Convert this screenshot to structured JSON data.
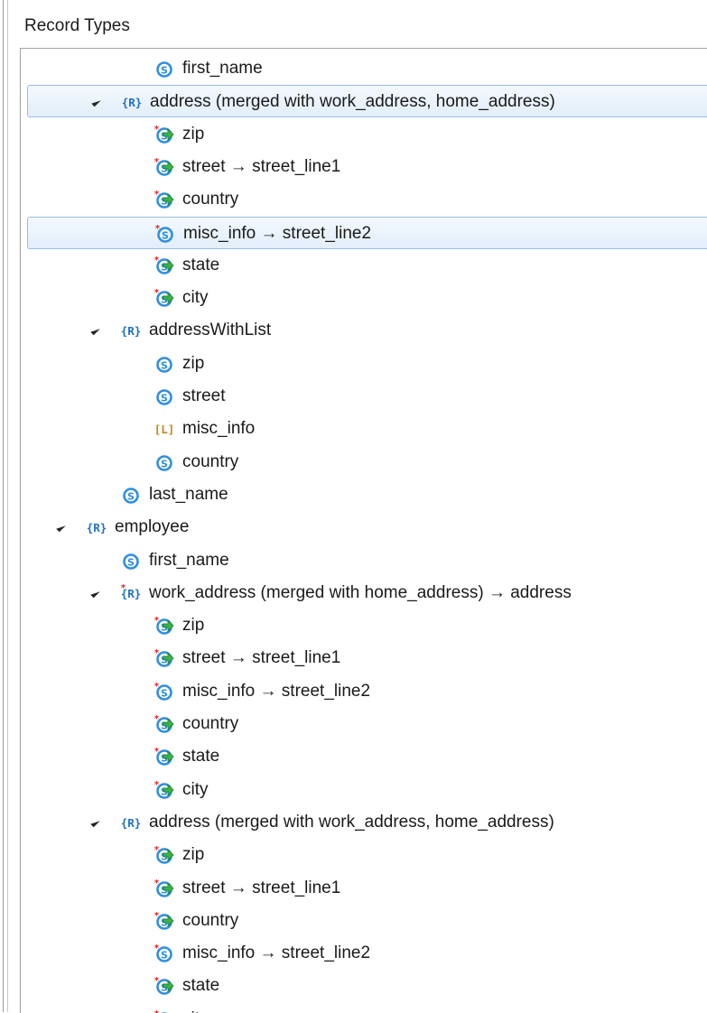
{
  "view": {
    "title": "Record Types"
  },
  "tree": {
    "rows": [
      {
        "label": "first_name",
        "type": "string"
      },
      {
        "label": "address (merged with work_address, home_address)",
        "type": "record",
        "expanded": true
      },
      {
        "label": "zip",
        "type": "string-mapped"
      },
      {
        "label": "street → street_line1",
        "type": "string-mapped"
      },
      {
        "label": "country",
        "type": "string-mapped"
      },
      {
        "label": "misc_info → street_line2",
        "type": "string-renamed"
      },
      {
        "label": "state",
        "type": "string-mapped"
      },
      {
        "label": "city",
        "type": "string-mapped"
      },
      {
        "label": "addressWithList",
        "type": "record",
        "expanded": true
      },
      {
        "label": "zip",
        "type": "string"
      },
      {
        "label": "street",
        "type": "string"
      },
      {
        "label": "misc_info",
        "type": "list"
      },
      {
        "label": "country",
        "type": "string"
      },
      {
        "label": "last_name",
        "type": "string"
      },
      {
        "label": "employee",
        "type": "record",
        "expanded": true
      },
      {
        "label": "first_name",
        "type": "string"
      },
      {
        "label": "work_address (merged with home_address) → address",
        "type": "record-renamed",
        "expanded": true
      },
      {
        "label": "zip",
        "type": "string-mapped"
      },
      {
        "label": "street → street_line1",
        "type": "string-mapped"
      },
      {
        "label": "misc_info → street_line2",
        "type": "string-renamed"
      },
      {
        "label": "country",
        "type": "string-mapped"
      },
      {
        "label": "state",
        "type": "string-mapped"
      },
      {
        "label": "city",
        "type": "string-mapped"
      },
      {
        "label": "address (merged with work_address, home_address)",
        "type": "record",
        "expanded": true
      },
      {
        "label": "zip",
        "type": "string-mapped"
      },
      {
        "label": "street → street_line1",
        "type": "string-mapped"
      },
      {
        "label": "country",
        "type": "string-mapped"
      },
      {
        "label": "misc_info → street_line2",
        "type": "string-renamed"
      },
      {
        "label": "state",
        "type": "string-mapped"
      },
      {
        "label": "city",
        "type": "string-mapped"
      }
    ]
  },
  "colors": {
    "string_icon": "#2f8fe0",
    "record_icon": "#1f6fc8",
    "list_icon": "#c08a1a",
    "mapped_arrow": "#37b34a",
    "change_star": "#e02020",
    "selection_border": "#9bbde0"
  }
}
